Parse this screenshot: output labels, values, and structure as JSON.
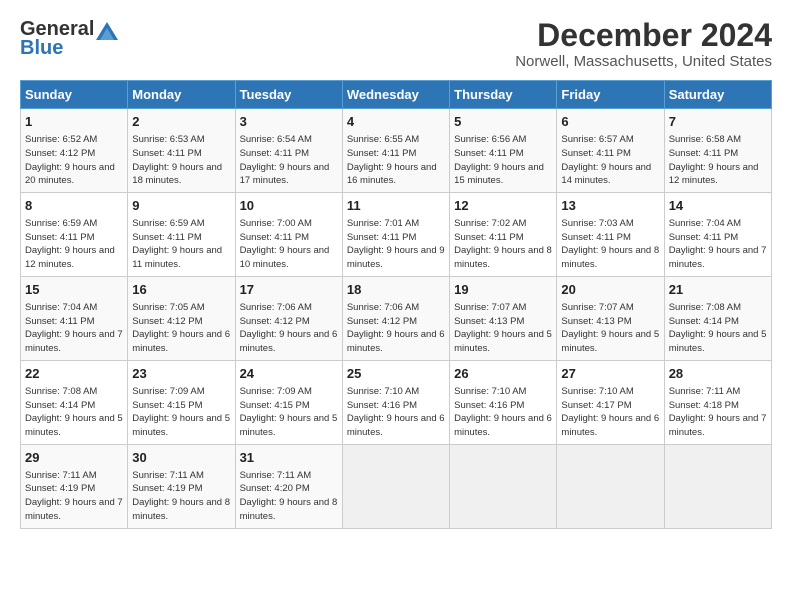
{
  "header": {
    "logo_general": "General",
    "logo_blue": "Blue",
    "month_title": "December 2024",
    "location": "Norwell, Massachusetts, United States"
  },
  "days_of_week": [
    "Sunday",
    "Monday",
    "Tuesday",
    "Wednesday",
    "Thursday",
    "Friday",
    "Saturday"
  ],
  "weeks": [
    [
      {
        "day": 1,
        "sunrise": "6:52 AM",
        "sunset": "4:12 PM",
        "daylight": "9 hours and 20 minutes."
      },
      {
        "day": 2,
        "sunrise": "6:53 AM",
        "sunset": "4:11 PM",
        "daylight": "9 hours and 18 minutes."
      },
      {
        "day": 3,
        "sunrise": "6:54 AM",
        "sunset": "4:11 PM",
        "daylight": "9 hours and 17 minutes."
      },
      {
        "day": 4,
        "sunrise": "6:55 AM",
        "sunset": "4:11 PM",
        "daylight": "9 hours and 16 minutes."
      },
      {
        "day": 5,
        "sunrise": "6:56 AM",
        "sunset": "4:11 PM",
        "daylight": "9 hours and 15 minutes."
      },
      {
        "day": 6,
        "sunrise": "6:57 AM",
        "sunset": "4:11 PM",
        "daylight": "9 hours and 14 minutes."
      },
      {
        "day": 7,
        "sunrise": "6:58 AM",
        "sunset": "4:11 PM",
        "daylight": "9 hours and 12 minutes."
      }
    ],
    [
      {
        "day": 8,
        "sunrise": "6:59 AM",
        "sunset": "4:11 PM",
        "daylight": "9 hours and 12 minutes."
      },
      {
        "day": 9,
        "sunrise": "6:59 AM",
        "sunset": "4:11 PM",
        "daylight": "9 hours and 11 minutes."
      },
      {
        "day": 10,
        "sunrise": "7:00 AM",
        "sunset": "4:11 PM",
        "daylight": "9 hours and 10 minutes."
      },
      {
        "day": 11,
        "sunrise": "7:01 AM",
        "sunset": "4:11 PM",
        "daylight": "9 hours and 9 minutes."
      },
      {
        "day": 12,
        "sunrise": "7:02 AM",
        "sunset": "4:11 PM",
        "daylight": "9 hours and 8 minutes."
      },
      {
        "day": 13,
        "sunrise": "7:03 AM",
        "sunset": "4:11 PM",
        "daylight": "9 hours and 8 minutes."
      },
      {
        "day": 14,
        "sunrise": "7:04 AM",
        "sunset": "4:11 PM",
        "daylight": "9 hours and 7 minutes."
      }
    ],
    [
      {
        "day": 15,
        "sunrise": "7:04 AM",
        "sunset": "4:11 PM",
        "daylight": "9 hours and 7 minutes."
      },
      {
        "day": 16,
        "sunrise": "7:05 AM",
        "sunset": "4:12 PM",
        "daylight": "9 hours and 6 minutes."
      },
      {
        "day": 17,
        "sunrise": "7:06 AM",
        "sunset": "4:12 PM",
        "daylight": "9 hours and 6 minutes."
      },
      {
        "day": 18,
        "sunrise": "7:06 AM",
        "sunset": "4:12 PM",
        "daylight": "9 hours and 6 minutes."
      },
      {
        "day": 19,
        "sunrise": "7:07 AM",
        "sunset": "4:13 PM",
        "daylight": "9 hours and 5 minutes."
      },
      {
        "day": 20,
        "sunrise": "7:07 AM",
        "sunset": "4:13 PM",
        "daylight": "9 hours and 5 minutes."
      },
      {
        "day": 21,
        "sunrise": "7:08 AM",
        "sunset": "4:14 PM",
        "daylight": "9 hours and 5 minutes."
      }
    ],
    [
      {
        "day": 22,
        "sunrise": "7:08 AM",
        "sunset": "4:14 PM",
        "daylight": "9 hours and 5 minutes."
      },
      {
        "day": 23,
        "sunrise": "7:09 AM",
        "sunset": "4:15 PM",
        "daylight": "9 hours and 5 minutes."
      },
      {
        "day": 24,
        "sunrise": "7:09 AM",
        "sunset": "4:15 PM",
        "daylight": "9 hours and 5 minutes."
      },
      {
        "day": 25,
        "sunrise": "7:10 AM",
        "sunset": "4:16 PM",
        "daylight": "9 hours and 6 minutes."
      },
      {
        "day": 26,
        "sunrise": "7:10 AM",
        "sunset": "4:16 PM",
        "daylight": "9 hours and 6 minutes."
      },
      {
        "day": 27,
        "sunrise": "7:10 AM",
        "sunset": "4:17 PM",
        "daylight": "9 hours and 6 minutes."
      },
      {
        "day": 28,
        "sunrise": "7:11 AM",
        "sunset": "4:18 PM",
        "daylight": "9 hours and 7 minutes."
      }
    ],
    [
      {
        "day": 29,
        "sunrise": "7:11 AM",
        "sunset": "4:19 PM",
        "daylight": "9 hours and 7 minutes."
      },
      {
        "day": 30,
        "sunrise": "7:11 AM",
        "sunset": "4:19 PM",
        "daylight": "9 hours and 8 minutes."
      },
      {
        "day": 31,
        "sunrise": "7:11 AM",
        "sunset": "4:20 PM",
        "daylight": "9 hours and 8 minutes."
      },
      null,
      null,
      null,
      null
    ]
  ]
}
